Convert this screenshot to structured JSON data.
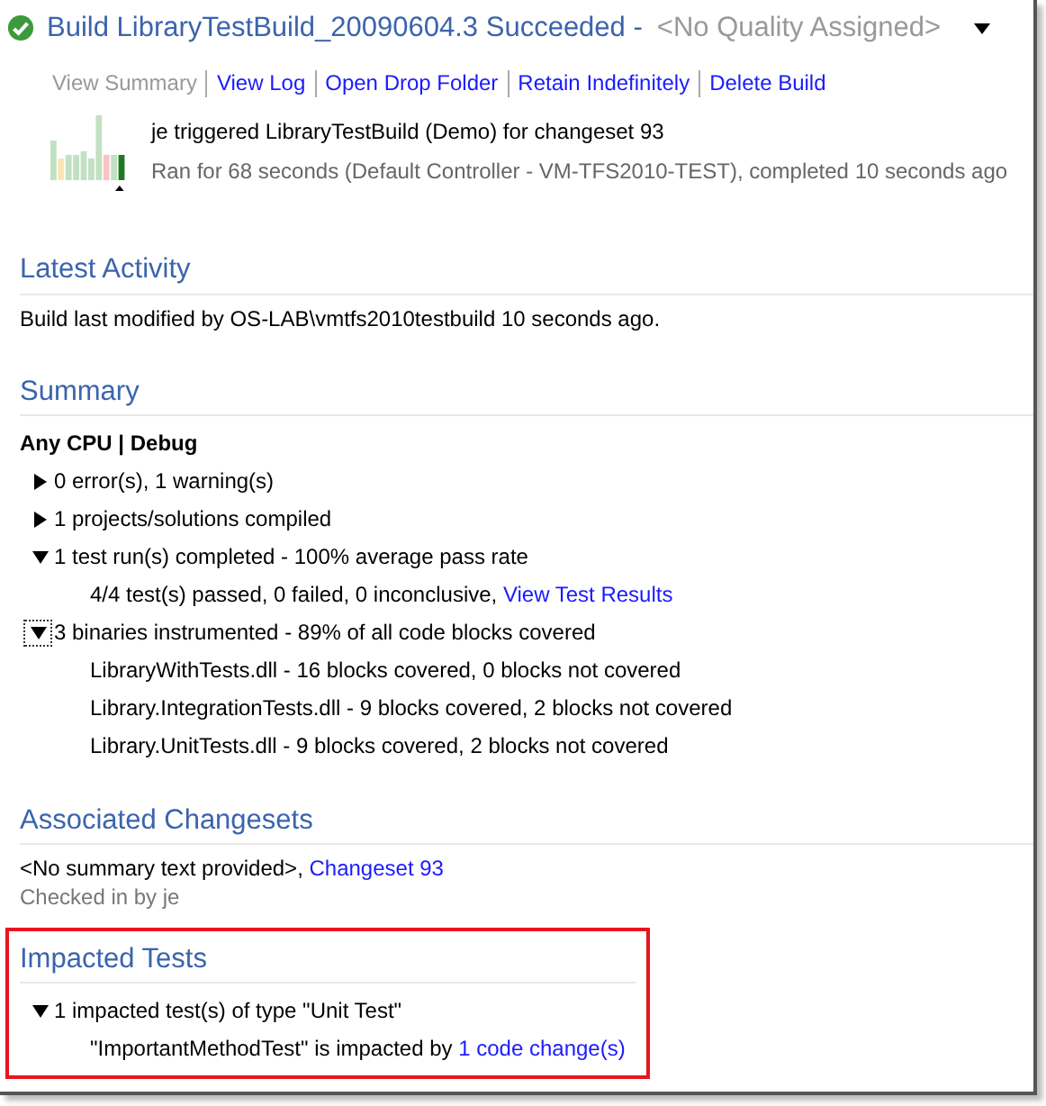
{
  "header": {
    "title": "Build LibraryTestBuild_20090604.3 Succeeded -",
    "quality": "<No Quality Assigned>"
  },
  "actions": [
    {
      "label": "View Summary",
      "selected": true
    },
    {
      "label": "View Log",
      "selected": false
    },
    {
      "label": "Open Drop Folder",
      "selected": false
    },
    {
      "label": "Retain Indefinitely",
      "selected": false
    },
    {
      "label": "Delete Build",
      "selected": false
    }
  ],
  "trigger": "je triggered LibraryTestBuild (Demo) for changeset 93",
  "run_info": "Ran for 68 seconds (Default Controller - VM-TFS2010-TEST), completed 10 seconds ago",
  "sections": [
    {
      "title": "Latest Activity",
      "highlighted": false,
      "items": [
        {
          "kind": "text",
          "text": "Build last modified by OS-LAB\\vmtfs2010testbuild 10 seconds ago."
        }
      ]
    },
    {
      "title": "Summary",
      "highlighted": false,
      "items": [
        {
          "kind": "heading",
          "text": "Any CPU | Debug"
        },
        {
          "kind": "node",
          "text": "0 error(s), 1 warning(s)",
          "expanded": false,
          "focused": false
        },
        {
          "kind": "node",
          "text": "1 projects/solutions compiled",
          "expanded": false,
          "focused": false
        },
        {
          "kind": "node",
          "text": "1 test run(s) completed - 100% average pass rate",
          "expanded": true,
          "focused": false,
          "children": [
            {
              "text": "4/4 test(s) passed, 0 failed, 0 inconclusive, ",
              "link": "View Test Results"
            }
          ]
        },
        {
          "kind": "node",
          "text": "3 binaries instrumented - 89% of all code blocks covered",
          "expanded": true,
          "focused": true,
          "children": [
            {
              "text": "LibraryWithTests.dll - 16 blocks covered, 0 blocks not covered"
            },
            {
              "text": "Library.IntegrationTests.dll - 9 blocks covered, 2 blocks not covered"
            },
            {
              "text": "Library.UnitTests.dll - 9 blocks covered, 2 blocks not covered"
            }
          ]
        }
      ]
    },
    {
      "title": "Associated Changesets",
      "highlighted": false,
      "items": [
        {
          "kind": "text",
          "text": "<No summary text provided>, ",
          "link": "Changeset 93"
        },
        {
          "kind": "text",
          "text": "Checked in by je",
          "muted": true
        }
      ]
    },
    {
      "title": "Impacted Tests",
      "highlighted": true,
      "items": [
        {
          "kind": "node",
          "text": "1 impacted test(s) of type \"Unit Test\"",
          "expanded": true,
          "focused": false,
          "children": [
            {
              "text": "\"ImportantMethodTest\" is impacted by ",
              "link": "1 code change(s)"
            }
          ]
        }
      ]
    }
  ]
}
